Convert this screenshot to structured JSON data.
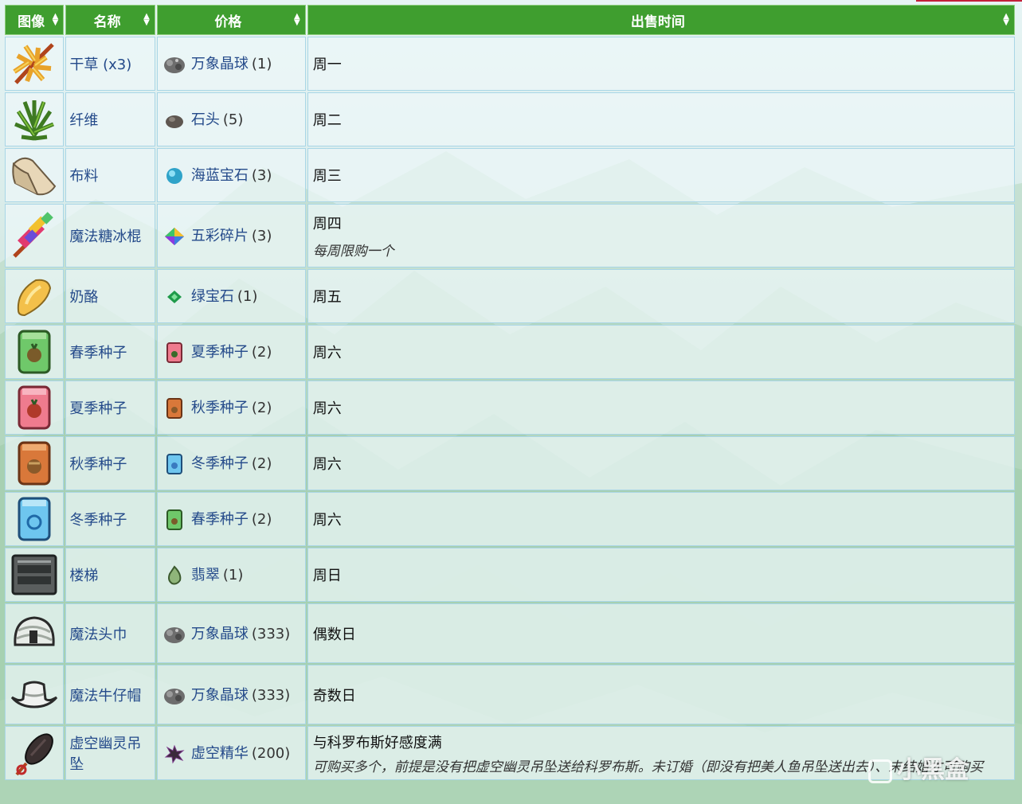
{
  "headers": {
    "image": "图像",
    "name": "名称",
    "price": "价格",
    "time": "出售时间"
  },
  "rows": [
    {
      "icon": "hay-icon",
      "name": "干草 (x3)",
      "price_item": "万象晶球",
      "price_qty": "(1)",
      "price_icon": "prismatic-orb-icon",
      "time": "周一"
    },
    {
      "icon": "fiber-icon",
      "name": "纤维",
      "price_item": "石头",
      "price_qty": "(5)",
      "price_icon": "stone-icon",
      "time": "周二"
    },
    {
      "icon": "cloth-icon",
      "name": "布料",
      "price_item": "海蓝宝石",
      "price_qty": "(3)",
      "price_icon": "aquamarine-icon",
      "time": "周三"
    },
    {
      "icon": "magic-rock-candy-icon",
      "name": "魔法糖冰棍",
      "price_item": "五彩碎片",
      "price_qty": "(3)",
      "price_icon": "prismatic-shard-icon",
      "time": "周四",
      "note": "每周限购一个"
    },
    {
      "icon": "cheese-icon",
      "name": "奶酪",
      "price_item": "绿宝石",
      "price_qty": "(1)",
      "price_icon": "emerald-icon",
      "time": "周五"
    },
    {
      "icon": "spring-seeds-icon",
      "name": "春季种子",
      "price_item": "夏季种子",
      "price_qty": "(2)",
      "price_icon": "summer-seeds-icon",
      "time": "周六"
    },
    {
      "icon": "summer-seeds-icon",
      "name": "夏季种子",
      "price_item": "秋季种子",
      "price_qty": "(2)",
      "price_icon": "fall-seeds-icon",
      "time": "周六"
    },
    {
      "icon": "fall-seeds-icon",
      "name": "秋季种子",
      "price_item": "冬季种子",
      "price_qty": "(2)",
      "price_icon": "winter-seeds-icon",
      "time": "周六"
    },
    {
      "icon": "winter-seeds-icon",
      "name": "冬季种子",
      "price_item": "春季种子",
      "price_qty": "(2)",
      "price_icon": "spring-seeds-icon",
      "time": "周六"
    },
    {
      "icon": "staircase-icon",
      "name": "楼梯",
      "price_item": "翡翠",
      "price_qty": "(1)",
      "price_icon": "jade-icon",
      "time": "周日"
    },
    {
      "icon": "magic-turban-icon",
      "name": "魔法头巾",
      "price_item": "万象晶球",
      "price_qty": "(333)",
      "price_icon": "prismatic-orb-icon",
      "time": "偶数日"
    },
    {
      "icon": "magic-cowboy-hat-icon",
      "name": "魔法牛仔帽",
      "price_item": "万象晶球",
      "price_qty": "(333)",
      "price_icon": "prismatic-orb-icon",
      "time": "奇数日"
    },
    {
      "icon": "void-ghost-pendant-icon",
      "name": "虚空幽灵吊坠",
      "price_item": "虚空精华",
      "price_qty": "(200)",
      "price_icon": "void-essence-icon",
      "time": "与科罗布斯好感度满",
      "note": "可购买多个，前提是没有把虚空幽灵吊坠送给科罗布斯。未订婚（即没有把美人鱼吊坠送出去）、未结婚才可购买"
    }
  ],
  "watermark": "小黑盒",
  "colors": {
    "header_bg": "#3f9e2f",
    "link": "#244a8a",
    "cell_border": "#a9d6e6",
    "top_strip": "#c4203a"
  }
}
